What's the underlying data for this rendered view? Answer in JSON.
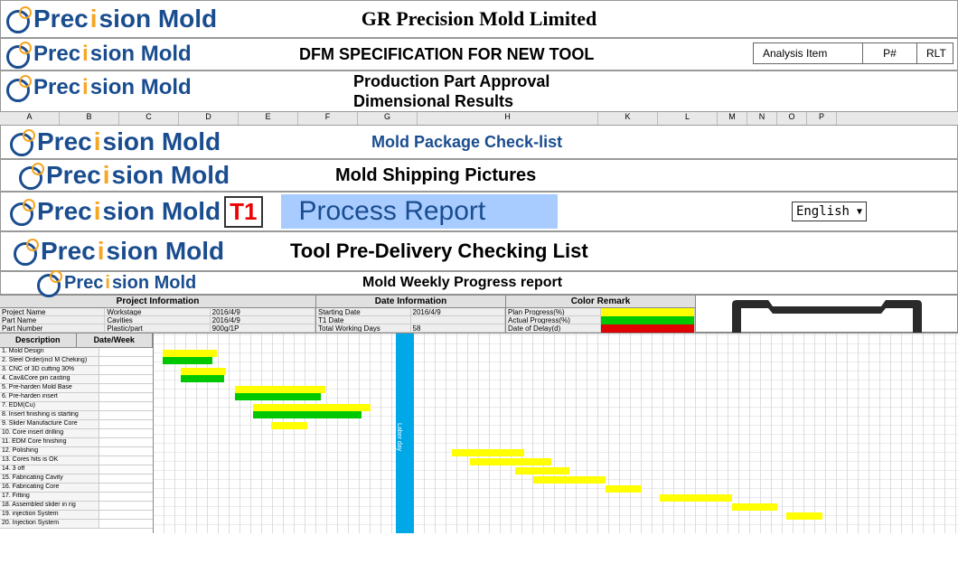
{
  "brand": {
    "name_pre": "Prec",
    "name_i": "i",
    "name_post": "sion Mold",
    "circle": "GR"
  },
  "titles": {
    "company": "GR Precision Mold Limited",
    "dfm": "DFM SPECIFICATION FOR NEW TOOL",
    "ppap1": "Production Part Approval",
    "ppap2": "Dimensional Results",
    "checklist": "Mold Package Check-list",
    "shipping": "Mold Shipping Pictures",
    "t1": "T1",
    "process": "Process Report",
    "predelivery": "Tool Pre-Delivery Checking List",
    "weekly": "Mold Weekly Progress report"
  },
  "analysis": {
    "label": "Analysis Item",
    "p": "P#",
    "rlt": "RLT"
  },
  "lang": "English",
  "cols": [
    "A",
    "B",
    "C",
    "D",
    "E",
    "F",
    "G",
    "H",
    "K",
    "L",
    "M",
    "N",
    "O",
    "P"
  ],
  "info": {
    "project": {
      "hdr": "Project Information",
      "rows": [
        {
          "k": "Project Name",
          "v": "Workstage",
          "d": "2016/4/9"
        },
        {
          "k": "Part Name",
          "v": "Cavities",
          "d": "2016/4/9"
        },
        {
          "k": "Part Number",
          "v": "Plastic/part",
          "d": "900g/1P"
        }
      ]
    },
    "date": {
      "hdr": "Date Information",
      "rows": [
        {
          "k": "Starting Date",
          "v": "2016/4/9"
        },
        {
          "k": "T1 Date",
          "v": ""
        },
        {
          "k": "Total Working Days",
          "v": "58"
        }
      ]
    },
    "color": {
      "hdr": "Color Remark",
      "rows": [
        {
          "k": "Plan Progress(%)",
          "c": "sw-y"
        },
        {
          "k": "Actual Progress(%)",
          "c": "sw-g"
        },
        {
          "k": "Date of Delay(d)",
          "c": "sw-r"
        }
      ]
    }
  },
  "gantt": {
    "left_hdr": {
      "desc": "Description",
      "date": "Date/Week"
    },
    "labor": "Labor day",
    "tasks": [
      {
        "name": "1. Mold Design",
        "date": ""
      },
      {
        "name": "2. Steel Order(incl M Cheking)",
        "date": ""
      },
      {
        "name": "3. CNC of 3D cutting 30%",
        "date": ""
      },
      {
        "name": "4. Cav&Core pin casting",
        "date": ""
      },
      {
        "name": "5. Pre-harden Mold Base",
        "date": ""
      },
      {
        "name": "6. Pre-harden insert",
        "date": ""
      },
      {
        "name": "7. EDM(Cu)",
        "date": ""
      },
      {
        "name": "8. Insert finishing is starting",
        "date": ""
      },
      {
        "name": "9. Slider Manufacture Core",
        "date": ""
      },
      {
        "name": "10. Core insert drilling",
        "date": ""
      },
      {
        "name": "11. EDM Core finishing",
        "date": ""
      },
      {
        "name": "12. Polishing",
        "date": ""
      },
      {
        "name": "13. Cores hits is OK",
        "date": ""
      },
      {
        "name": "14. 3 off",
        "date": ""
      },
      {
        "name": "15. Fabricating Cavity",
        "date": ""
      },
      {
        "name": "16. Fabricating Core",
        "date": ""
      },
      {
        "name": "17. Fitting",
        "date": ""
      },
      {
        "name": "18. Assembled slider in rig",
        "date": ""
      },
      {
        "name": "19. injection System",
        "date": ""
      },
      {
        "name": "20. Injection System",
        "date": ""
      }
    ]
  }
}
